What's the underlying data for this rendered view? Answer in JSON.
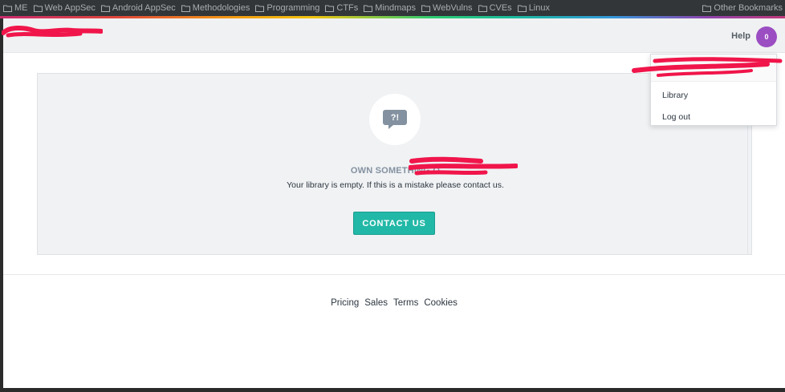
{
  "bookmarks": {
    "items": [
      "ME",
      "Web AppSec",
      "Android AppSec",
      "Methodologies",
      "Programming",
      "CTFs",
      "Mindmaps",
      "WebVulns",
      "CVEs",
      "Linux"
    ],
    "other": "Other Bookmarks"
  },
  "header": {
    "help_label": "Help",
    "avatar_initial": "0"
  },
  "empty_state": {
    "heading": "OWN SOMETHING O",
    "message": "Your library is empty. If this is a mistake please contact us.",
    "button_label": "CONTACT US",
    "icon_glyph": "?!"
  },
  "dropdown": {
    "items": [
      "Library",
      "Log out"
    ]
  },
  "footer": {
    "links": [
      "Pricing",
      "Sales",
      "Terms",
      "Cookies"
    ]
  },
  "colors": {
    "accent": "#22b8a7",
    "avatar": "#9b4dc2",
    "redaction": "#f0154a"
  }
}
